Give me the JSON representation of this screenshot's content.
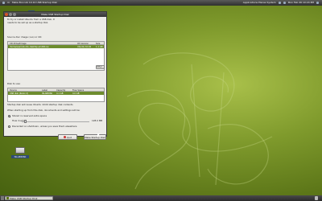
{
  "topbar": {
    "left_items": [
      "m",
      "Make USB Startup Disk - Firefox",
      "d",
      "g",
      "e"
    ],
    "left_text_1": "m",
    "left_text_2": "Make Boo Lib 10.10 USB Startup Disk",
    "right_text": "Applications  Places  System",
    "clock": "Mon Feb 26 10:24 PM"
  },
  "desktop": {
    "label_top": "ubuntu",
    "drive_label": "ISLABDISK"
  },
  "window": {
    "title": "Make USB Startup Disk",
    "intro_line1": "To try or install Ubuntu from a USB disk, it",
    "intro_line2": "needs to be set up as a startup disk.",
    "source_label": "Source disc image (.iso) or CD:",
    "source_cols": [
      "CD-Drive/Image",
      "OS Version",
      "Size"
    ],
    "source_row": [
      "/home/user/ubuntu-desktop-amd64.iso",
      "Ubuntu 10.04",
      "1.1 GB"
    ],
    "other_button": "Other...",
    "disk_label": "Disk to use:",
    "disk_cols": [
      "Device",
      "Label",
      "Capacity",
      "Free Space"
    ],
    "disk_row": [
      "USB disk (Kanix 2)",
      "ISLABDISK",
      "4.1 GB",
      "4.0 GB"
    ],
    "free_note": "Startup disk will reuse Ubuntu 10.04 startup disk contents",
    "persist_label": "When starting up from this disk, documents and settings will be:",
    "opt_store": "Stored in reserved extra space",
    "slider_label": "How much:",
    "slider_value": "128.0 MB",
    "opt_discard": "Discarded on shutdown, unless you save them elsewhere",
    "quit_button": "Quit",
    "make_button": "Make Startup Disk"
  },
  "taskbar": {
    "window_button": "Make USB Startup Disk"
  },
  "colors": {
    "accent": "#6d8c2e",
    "desktop": "#7f9a2c"
  }
}
